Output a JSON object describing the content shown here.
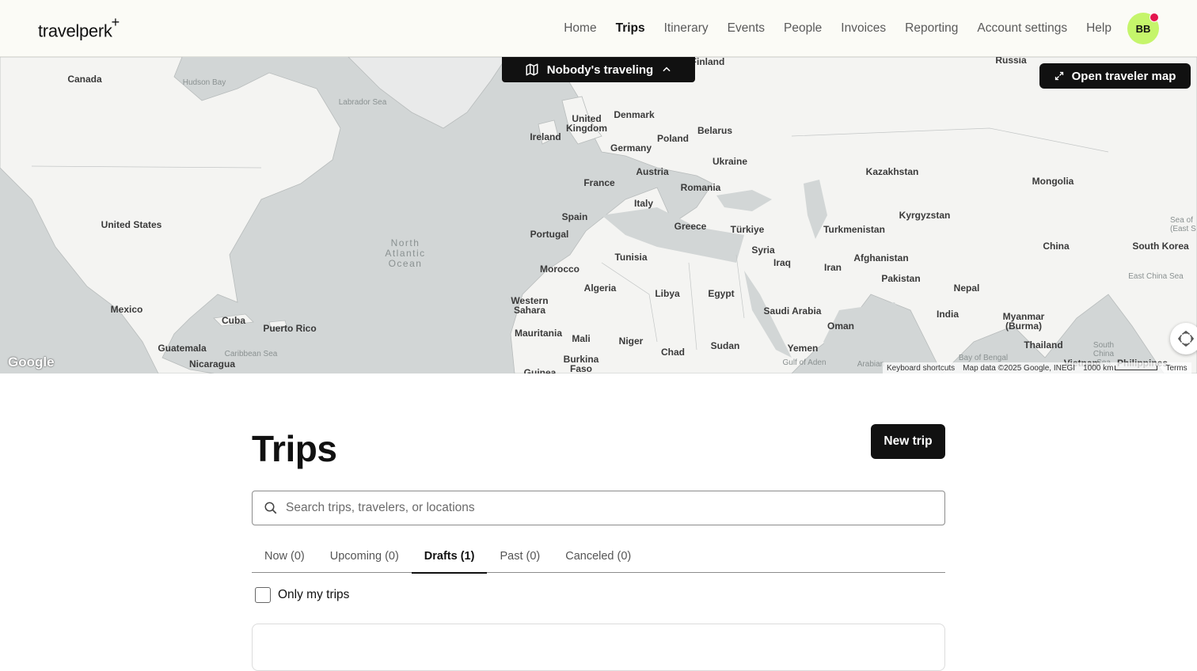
{
  "header": {
    "logo": "travelperk",
    "logo_mark": "+",
    "nav": [
      {
        "label": "Home",
        "active": false
      },
      {
        "label": "Trips",
        "active": true
      },
      {
        "label": "Itinerary",
        "active": false
      },
      {
        "label": "Events",
        "active": false
      },
      {
        "label": "People",
        "active": false
      },
      {
        "label": "Invoices",
        "active": false
      },
      {
        "label": "Reporting",
        "active": false
      },
      {
        "label": "Account settings",
        "active": false
      },
      {
        "label": "Help",
        "active": false
      }
    ],
    "avatar_initials": "BB",
    "avatar_color": "#c5f56b",
    "notification_color": "#e3154d"
  },
  "map": {
    "traveling_label": "Nobody's traveling",
    "traveling_icon": "map-icon",
    "traveling_chevron": "chevron-up-icon",
    "open_map_label": "Open traveler map",
    "open_map_icon": "expand-icon",
    "fullscreen_icon": "fullscreen-icon",
    "google": "Google",
    "attribution": {
      "shortcuts": "Keyboard shortcuts",
      "data": "Map data ©2025 Google, INEGI",
      "scale": "1000 km",
      "terms": "Terms"
    },
    "countries": [
      "Canada",
      "United States",
      "Mexico",
      "Cuba",
      "Puerto Rico",
      "Guatemala",
      "Nicaragua",
      "Ireland",
      "United Kingdom",
      "Denmark",
      "Poland",
      "Belarus",
      "Germany",
      "Ukraine",
      "France",
      "Austria",
      "Romania",
      "Italy",
      "Spain",
      "Portugal",
      "Greece",
      "Türkiye",
      "Tunisia",
      "Morocco",
      "Algeria",
      "Libya",
      "Egypt",
      "Western Sahara",
      "Mauritania",
      "Mali",
      "Niger",
      "Chad",
      "Sudan",
      "Burkina Faso",
      "Syria",
      "Iraq",
      "Iran",
      "Saudi Arabia",
      "Oman",
      "Yemen",
      "Kazakhstan",
      "Turkmenistan",
      "Afghanistan",
      "Pakistan",
      "Kyrgyzstan",
      "Mongolia",
      "China",
      "South Korea",
      "Nepal",
      "India",
      "Myanmar (Burma)",
      "Thailand",
      "Vietnam",
      "Philippines",
      "Russia",
      "Finland",
      "Guinea"
    ],
    "waters": [
      "Hudson Bay",
      "Labrador Sea",
      "Caribbean Sea",
      "Gulf of Aden",
      "Arabian",
      "Bay of Bengal",
      "East China Sea",
      "South China Sea",
      "Sea of (East S"
    ],
    "ocean": "North Atlantic Ocean"
  },
  "main": {
    "title": "Trips",
    "new_trip_label": "New trip",
    "search_placeholder": "Search trips, travelers, or locations",
    "tabs": [
      {
        "label": "Now (0)",
        "active": false
      },
      {
        "label": "Upcoming (0)",
        "active": false
      },
      {
        "label": "Drafts (1)",
        "active": true
      },
      {
        "label": "Past (0)",
        "active": false
      },
      {
        "label": "Canceled (0)",
        "active": false
      }
    ],
    "only_my_trips_label": "Only my trips",
    "only_my_trips_checked": false
  }
}
